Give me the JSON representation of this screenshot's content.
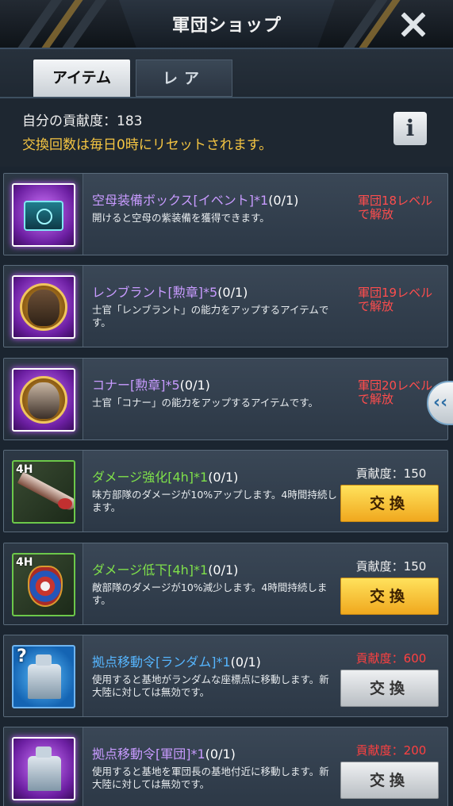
{
  "header": {
    "title": "軍団ショップ",
    "close_icon": "close-icon"
  },
  "tabs": [
    {
      "label": "アイテム",
      "active": true
    },
    {
      "label": "レア",
      "active": false
    }
  ],
  "info": {
    "contribution": "自分の貢献度：183",
    "reset_note": "交換回数は毎日0時にリセットされます。",
    "info_icon": "i"
  },
  "items": [
    {
      "name": "空母装備ボックス[イベント]*1",
      "count": "(0/1)",
      "desc": "開けると空母の紫装備を獲得できます。",
      "locked": "軍団18レベルで解放",
      "rarity": "purple",
      "icon": "crate-icon"
    },
    {
      "name": "レンブラント[勲章]*5",
      "count": "(0/1)",
      "desc": "士官「レンブラント」の能力をアップするアイテムです。",
      "locked": "軍団19レベルで解放",
      "rarity": "purple",
      "icon": "medal-icon"
    },
    {
      "name": "コナー[勲章]*5",
      "count": "(0/1)",
      "desc": "士官「コナー」の能力をアップするアイテムです。",
      "locked": "軍団20レベルで解放",
      "rarity": "purple",
      "icon": "medal-icon"
    },
    {
      "name": "ダメージ強化[4h]*1",
      "count": "(0/1)",
      "desc": "味方部隊のダメージが10%アップします。4時間持続します。",
      "cost": "貢献度：150",
      "button": "交換",
      "rarity": "green",
      "icon_label": "4H",
      "icon": "bullet-icon"
    },
    {
      "name": "ダメージ低下[4h]*1",
      "count": "(0/1)",
      "desc": "敵部隊のダメージが10%減少します。4時間持続します。",
      "cost": "貢献度：150",
      "button": "交換",
      "rarity": "green",
      "icon_label": "4H",
      "icon": "shield-icon"
    },
    {
      "name": "拠点移動令[ランダム]*1",
      "count": "(0/1)",
      "desc": "使用すると基地がランダムな座標点に移動します。新大陸に対しては無効です。",
      "cost": "貢献度：600",
      "button": "交換",
      "rarity": "blue",
      "icon_label": "?",
      "icon": "relocation-icon"
    },
    {
      "name": "拠点移動令[軍団]*1",
      "count": "(0/1)",
      "desc": "使用すると基地を軍団長の基地付近に移動します。新大陸に対しては無効です。",
      "cost": "貢献度：200",
      "button": "交換",
      "rarity": "purple",
      "icon": "relocation-icon"
    }
  ],
  "side_handle": "‹‹",
  "colors": {
    "accent_gold": "#f5c542",
    "locked_red": "#ff4d4d",
    "title_purple": "#c89bff",
    "title_green": "#7fe04a",
    "title_blue": "#56b6ff"
  }
}
